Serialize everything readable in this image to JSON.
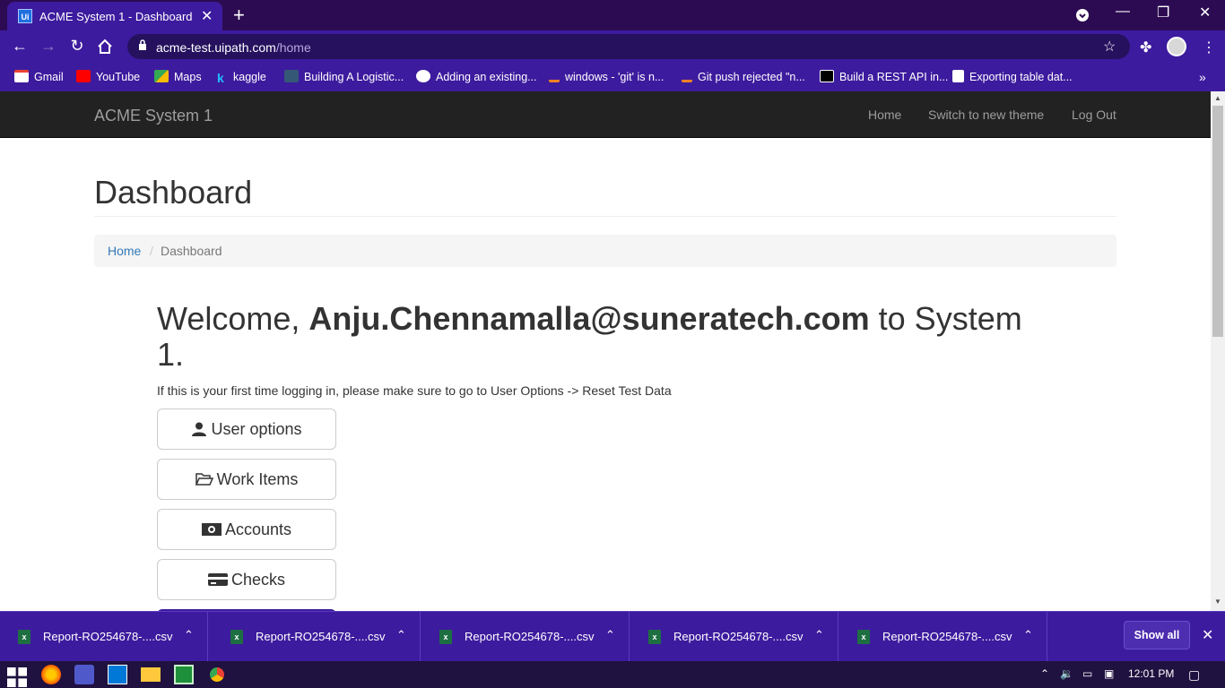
{
  "browser": {
    "tab_title": "ACME System 1 - Dashboard",
    "tab_favicon": "Ui",
    "url_host": "acme-test.uipath.com",
    "url_path": "/home",
    "bookmarks": [
      {
        "label": "Gmail",
        "icon": "gmail-icon"
      },
      {
        "label": "YouTube",
        "icon": "youtube-icon"
      },
      {
        "label": "Maps",
        "icon": "maps-icon"
      },
      {
        "label": "kaggle",
        "icon": "kaggle-icon"
      },
      {
        "label": "Building A Logistic...",
        "icon": "tds-icon"
      },
      {
        "label": "Adding an existing...",
        "icon": "github-icon"
      },
      {
        "label": "windows - 'git' is n...",
        "icon": "stackoverflow-icon"
      },
      {
        "label": "Git push rejected \"n...",
        "icon": "stackoverflow-icon"
      },
      {
        "label": "Build a REST API in...",
        "icon": "medium-icon"
      },
      {
        "label": "Exporting table dat...",
        "icon": "sheet-icon"
      }
    ]
  },
  "app": {
    "brand": "ACME System 1",
    "nav": {
      "home": "Home",
      "switch_theme": "Switch to new theme",
      "logout": "Log Out"
    },
    "page_title": "Dashboard",
    "breadcrumb": {
      "home": "Home",
      "sep": "/",
      "current": "Dashboard"
    },
    "welcome": {
      "prefix": "Welcome, ",
      "user": "Anju.Chennamalla@suneratech.com",
      "suffix": " to System 1."
    },
    "hint": "If this is your first time logging in, please make sure to go to User Options -> Reset Test Data",
    "buttons": {
      "user_options": "User options",
      "work_items": "Work Items",
      "accounts": "Accounts",
      "checks": "Checks"
    }
  },
  "downloads": {
    "items": [
      "Report-RO254678-....csv",
      "Report-RO254678-....csv",
      "Report-RO254678-....csv",
      "Report-RO254678-....csv",
      "Report-RO254678-....csv"
    ],
    "file_badge": "x",
    "show_all": "Show all"
  },
  "taskbar": {
    "clock": "12:01 PM"
  },
  "colors": {
    "chrome_purple": "#3d1b9e",
    "navbar": "#222222",
    "link": "#337ab7"
  }
}
